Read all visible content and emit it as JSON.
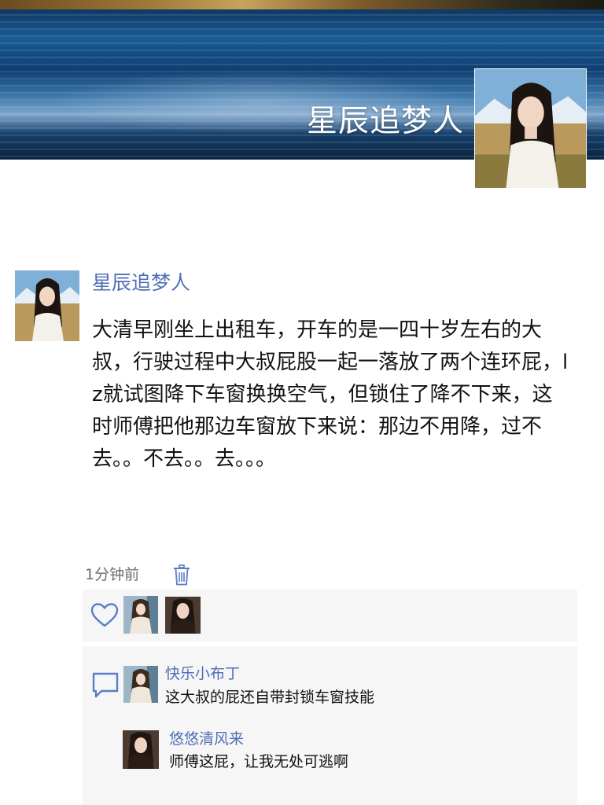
{
  "cover": {
    "title": "星辰追梦人",
    "avatar_icon": "user-avatar-photo"
  },
  "post": {
    "author": "星辰追梦人",
    "text": "大清早刚坐上出租车，开车的是一四十岁左右的大叔，行驶过程中大叔屁股一起一落放了两个连环屁，lz就试图降下车窗换换空气，但锁住了降不下来，这时师傅把他那边车窗放下来说：那边不用降，过不去。。不去。。去。。。",
    "time": "1分钟前",
    "delete_icon": "trash-icon"
  },
  "likes": {
    "icon": "heart-icon",
    "avatars": [
      "liker-avatar-1",
      "liker-avatar-2"
    ]
  },
  "comments": {
    "icon": "comment-icon",
    "items": [
      {
        "user": "快乐小布丁",
        "text": "这大叔的屁还自带封锁车窗技能"
      },
      {
        "user": "悠悠清风来",
        "text": "师傅这屁，让我无处可逃啊"
      }
    ]
  },
  "colors": {
    "link_blue": "#4e6fb8",
    "icon_blue": "#5a7dc8",
    "panel_gray": "#f6f6f6",
    "time_gray": "#6e6e6e"
  }
}
